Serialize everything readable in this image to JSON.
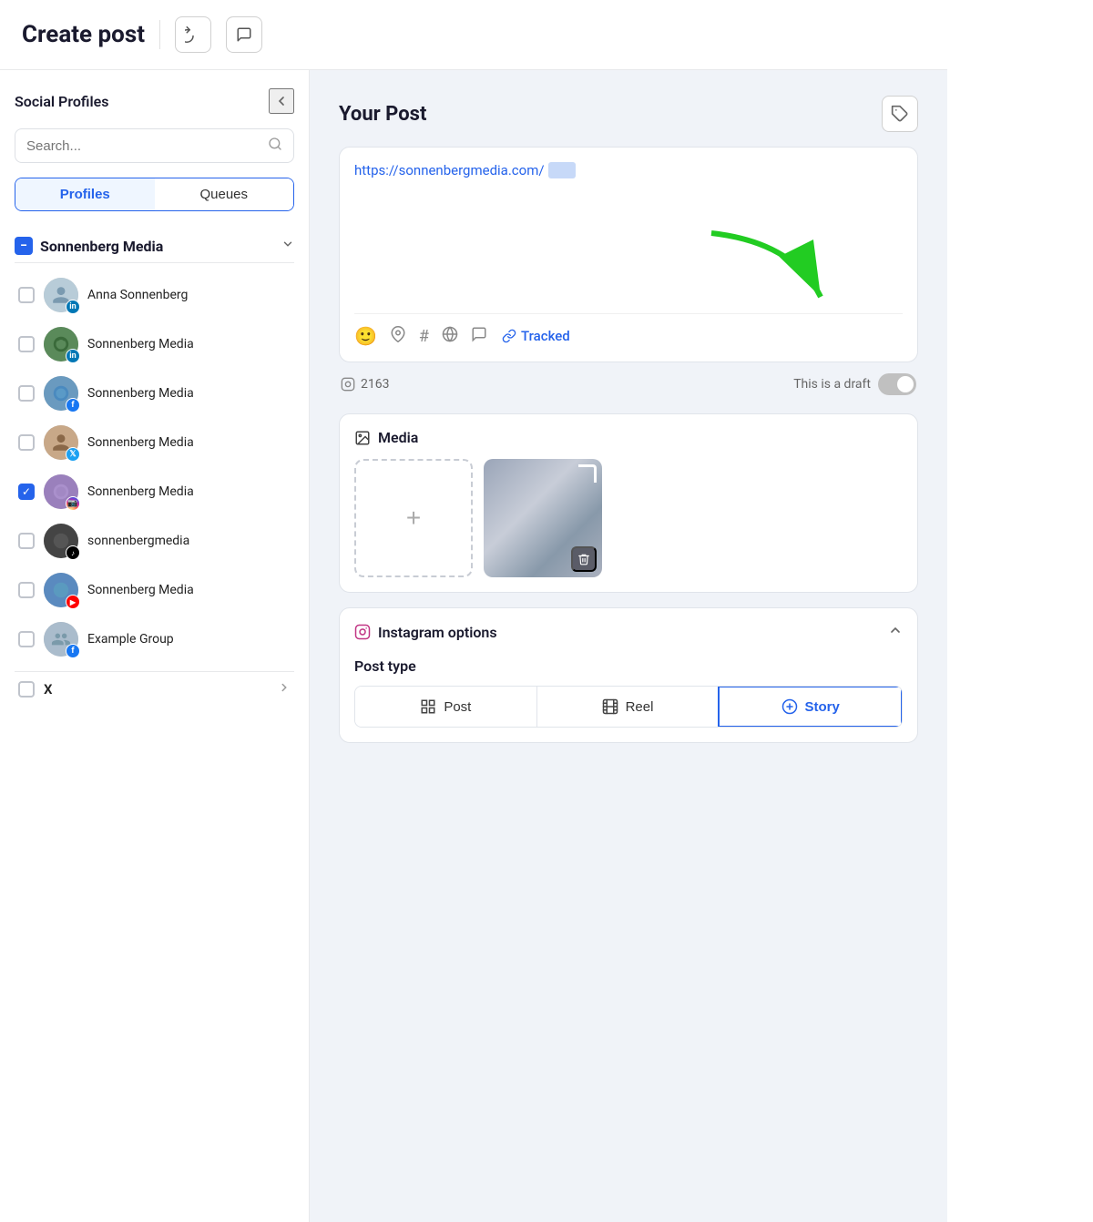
{
  "header": {
    "title": "Create post",
    "undo_label": "↺",
    "chat_label": "💬"
  },
  "sidebar": {
    "title": "Social Profiles",
    "search_placeholder": "Search...",
    "tabs": [
      {
        "id": "profiles",
        "label": "Profiles",
        "active": true
      },
      {
        "id": "queues",
        "label": "Queues",
        "active": false
      }
    ],
    "group": {
      "name": "Sonnenberg Media",
      "profiles": [
        {
          "id": 1,
          "name": "Anna Sonnenberg",
          "network": "linkedin",
          "checked": false,
          "avatar_color": "#9db5c8",
          "emoji": "👤"
        },
        {
          "id": 2,
          "name": "Sonnenberg Media",
          "network": "linkedin",
          "checked": false,
          "avatar_color": "#5a8a5a",
          "emoji": "🌐"
        },
        {
          "id": 3,
          "name": "Sonnenberg Media",
          "network": "facebook",
          "checked": false,
          "avatar_color": "#4a7abf",
          "emoji": "🌐"
        },
        {
          "id": 4,
          "name": "Sonnenberg Media",
          "network": "twitter",
          "checked": false,
          "avatar_color": "#8a7a6a",
          "emoji": "👤"
        },
        {
          "id": 5,
          "name": "Sonnenberg Media",
          "network": "instagram",
          "checked": true,
          "avatar_color": "#8a6aaa",
          "emoji": "🌐"
        },
        {
          "id": 6,
          "name": "sonnenbergmedia",
          "network": "tiktok",
          "checked": false,
          "avatar_color": "#555",
          "emoji": "⚫"
        },
        {
          "id": 7,
          "name": "Sonnenberg Media",
          "network": "youtube",
          "checked": false,
          "avatar_color": "#4a7abf",
          "emoji": "🌐"
        },
        {
          "id": 8,
          "name": "Example Group",
          "network": "facebook",
          "checked": false,
          "avatar_color": "#9db5c8",
          "emoji": "👥"
        }
      ]
    },
    "extra_group": {
      "label": "X",
      "has_chevron": true
    }
  },
  "main": {
    "post_section": {
      "title": "Your Post",
      "url": "https://sonnenbergmedia.com/",
      "url_highlight": "       ",
      "char_count": "2163",
      "draft_label": "This is a draft",
      "toolbar_icons": [
        "😊",
        "📍",
        "#",
        "🌐",
        "💬",
        "🔗"
      ],
      "tracked_label": "Tracked"
    },
    "media_section": {
      "title": "Media",
      "add_label": "+"
    },
    "instagram_options": {
      "title": "Instagram options",
      "post_type_label": "Post type",
      "post_types": [
        {
          "id": "post",
          "label": "Post",
          "icon": "⊞",
          "active": false
        },
        {
          "id": "reel",
          "label": "Reel",
          "icon": "🎬",
          "active": false
        },
        {
          "id": "story",
          "label": "Story",
          "icon": "⊕",
          "active": true
        }
      ]
    }
  },
  "colors": {
    "accent": "#2563eb",
    "green_arrow": "#22cc22",
    "checked": "#2563eb"
  },
  "icons": {
    "search": "🔍",
    "tag": "🏷",
    "media": "🖼",
    "instagram": "📷",
    "chevron_up": "∧",
    "chevron_down": "∨",
    "collapse": "<",
    "trash": "🗑",
    "link": "🔗"
  }
}
